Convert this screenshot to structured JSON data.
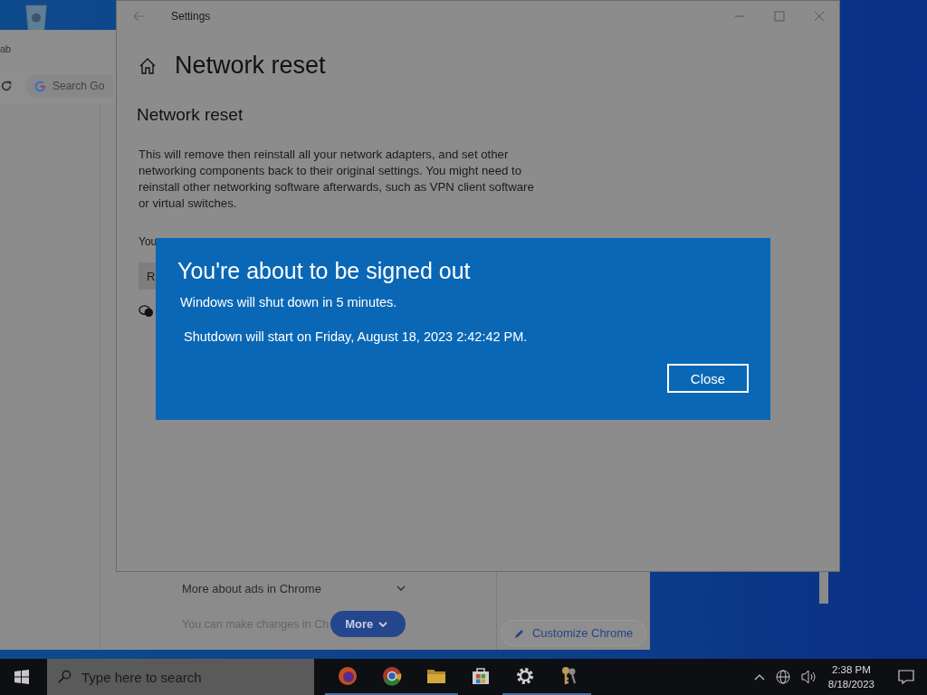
{
  "browser_window": {
    "tab_title": "ab",
    "search": {
      "placeholder": "Search Go"
    },
    "rows": [
      {
        "label": "More about ads in Chrome",
        "expanded": false
      }
    ],
    "note": "You can make changes in Ch",
    "more_button": "More",
    "customize_button": "Customize Chrome"
  },
  "settings_window": {
    "title": "Settings",
    "page_title": "Network reset",
    "section_title": "Network reset",
    "description": "This will remove then reinstall all your network adapters, and set other networking components back to their original settings. You might need to reinstall other networking software afterwards, such as VPN client software or virtual switches.",
    "partial_text": "You",
    "partial_button": "R"
  },
  "dialog": {
    "title": "You're about to be signed out",
    "lines": [
      "Windows will shut down in 5 minutes.",
      "Shutdown will start on Friday, August 18, 2023 2:42:42 PM."
    ],
    "button": "Close"
  },
  "taskbar": {
    "search": {
      "placeholder": "Type here to search"
    },
    "apps": [
      {
        "kind": "firefox",
        "running": true
      },
      {
        "kind": "chrome",
        "running": true
      },
      {
        "kind": "folder",
        "running": true
      },
      {
        "kind": "store",
        "running": false
      },
      {
        "kind": "gear",
        "running": true
      },
      {
        "kind": "keys",
        "running": true
      }
    ],
    "time": "2:38 PM",
    "date": "8/18/2023"
  }
}
